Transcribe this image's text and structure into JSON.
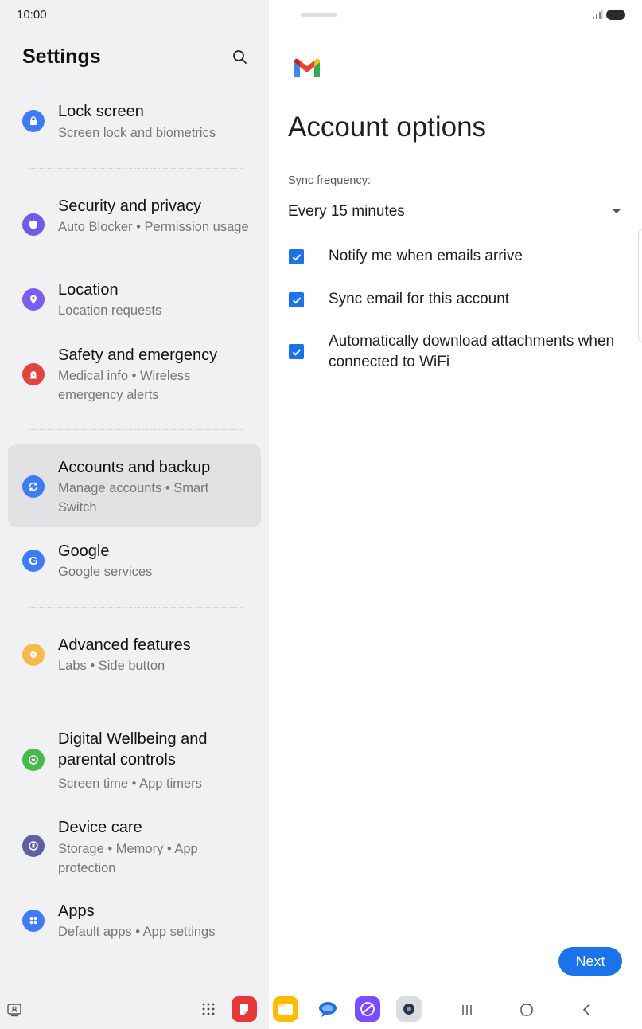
{
  "status_bar": {
    "time": "10:00"
  },
  "settings": {
    "title": "Settings",
    "items": [
      {
        "title": "Lock screen",
        "subtitle": "Screen lock and biometrics",
        "icon": "lock-icon",
        "color": "#3d7bf7"
      },
      {
        "title": "Security and privacy",
        "subtitle": "Auto Blocker • Permission usage",
        "icon": "shield-icon",
        "color": "#6c5ce7"
      },
      {
        "title": "Location",
        "subtitle": "Location requests",
        "icon": "location-pin-icon",
        "color": "#7b5cf0"
      },
      {
        "title": "Safety and emergency",
        "subtitle": "Medical info • Wireless emergency alerts",
        "icon": "emergency-siren-icon",
        "color": "#e0463f"
      },
      {
        "title": "Accounts and backup",
        "subtitle": "Manage accounts • Smart Switch",
        "icon": "sync-icon",
        "color": "#3d7bf7"
      },
      {
        "title": "Google",
        "subtitle": "Google services",
        "icon": "google-g-icon",
        "color": "#3d7bf7"
      },
      {
        "title": "Advanced features",
        "subtitle": "Labs • Side button",
        "icon": "gear-star-icon",
        "color": "#f9b94a"
      },
      {
        "title": "Digital Wellbeing and parental controls",
        "subtitle": "Screen time • App timers",
        "icon": "wellbeing-heart-icon",
        "color": "#47b84a"
      },
      {
        "title": "Device care",
        "subtitle": "Storage • Memory • App protection",
        "icon": "device-care-icon",
        "color": "#5f5fa8"
      },
      {
        "title": "Apps",
        "subtitle": "Default apps • App settings",
        "icon": "apps-grid-icon",
        "color": "#3d7bf7"
      }
    ]
  },
  "account_options": {
    "title": "Account options",
    "sync_label": "Sync frequency:",
    "sync_value": "Every 15 minutes",
    "checkboxes": [
      {
        "label": "Notify me when emails arrive",
        "checked": true
      },
      {
        "label": "Sync email for this account",
        "checked": true
      },
      {
        "label": "Automatically download attachments when connected to WiFi",
        "checked": true
      }
    ],
    "next_label": "Next"
  },
  "colors": {
    "accent": "#1a73e8",
    "left_pane_bg": "#f1f1f3",
    "active_item_bg": "#e2e2e5"
  }
}
